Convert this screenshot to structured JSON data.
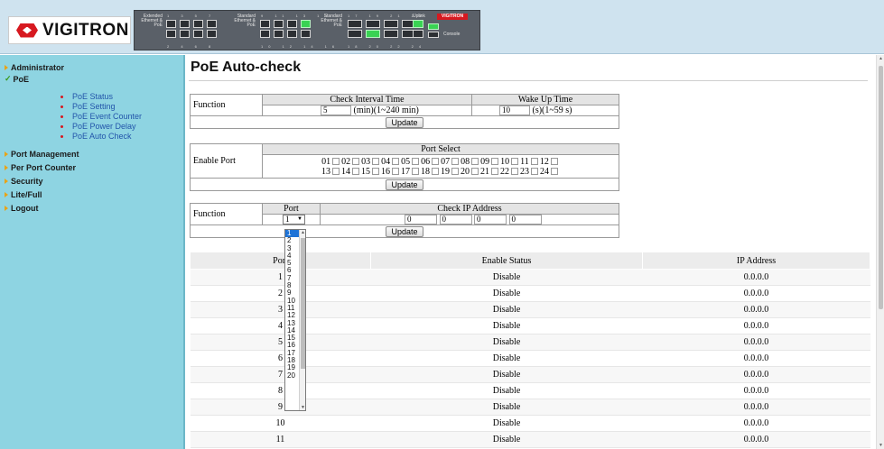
{
  "header": {
    "brand": "VIGITRON",
    "panel_labels": {
      "extended": "Extended Ethernet & PoE",
      "standard1": "Standard Ethernet & PoE",
      "standard2": "Standard Ethernet & PoE",
      "uplink": "Uplink",
      "console": "Console",
      "mini_brand": "VIGITRON"
    }
  },
  "sidebar": {
    "top_items": [
      {
        "label": "Administrator",
        "icon": "arrow-icon"
      },
      {
        "label": "PoE",
        "icon": "check-icon"
      },
      {
        "label": "Port Management",
        "icon": "arrow-icon"
      },
      {
        "label": "Per Port Counter",
        "icon": "arrow-icon"
      },
      {
        "label": "Security",
        "icon": "arrow-icon"
      },
      {
        "label": "Lite/Full",
        "icon": "arrow-icon"
      },
      {
        "label": "Logout",
        "icon": "arrow-icon"
      }
    ],
    "poe_sub_items": [
      {
        "label": "PoE Status"
      },
      {
        "label": "PoE Setting"
      },
      {
        "label": "PoE Event Counter"
      },
      {
        "label": "PoE Power Delay"
      },
      {
        "label": "PoE Auto Check"
      }
    ]
  },
  "main": {
    "title": "PoE Auto-check",
    "interval_table": {
      "row_label": "Function",
      "col1_header": "Check Interval Time",
      "col2_header": "Wake Up Time",
      "interval_value": "5",
      "interval_unit": "(min)(1~240 min)",
      "wake_value": "10",
      "wake_unit": "(s)(1~59 s)",
      "update_label": "Update"
    },
    "enable_table": {
      "row_label": "Enable Port",
      "header": "Port Select",
      "ports_row1": [
        "01",
        "02",
        "03",
        "04",
        "05",
        "06",
        "07",
        "08",
        "09",
        "10",
        "11",
        "12"
      ],
      "ports_row2": [
        "13",
        "14",
        "15",
        "16",
        "17",
        "18",
        "19",
        "20",
        "21",
        "22",
        "23",
        "24"
      ],
      "update_label": "Update"
    },
    "ip_table": {
      "row_label": "Function",
      "port_header": "Port",
      "ip_header": "Check IP Address",
      "port_value": "1",
      "ip_octets": [
        "0",
        "0",
        "0",
        "0"
      ],
      "update_label": "Update"
    },
    "dropdown_options": [
      "1",
      "2",
      "3",
      "4",
      "5",
      "6",
      "7",
      "8",
      "9",
      "10",
      "11",
      "12",
      "13",
      "14",
      "15",
      "16",
      "17",
      "18",
      "19",
      "20"
    ],
    "status_table": {
      "headers": [
        "Port",
        "Enable Status",
        "IP Address"
      ],
      "rows": [
        {
          "port": "1",
          "status": "Disable",
          "ip": "0.0.0.0"
        },
        {
          "port": "2",
          "status": "Disable",
          "ip": "0.0.0.0"
        },
        {
          "port": "3",
          "status": "Disable",
          "ip": "0.0.0.0"
        },
        {
          "port": "4",
          "status": "Disable",
          "ip": "0.0.0.0"
        },
        {
          "port": "5",
          "status": "Disable",
          "ip": "0.0.0.0"
        },
        {
          "port": "6",
          "status": "Disable",
          "ip": "0.0.0.0"
        },
        {
          "port": "7",
          "status": "Disable",
          "ip": "0.0.0.0"
        },
        {
          "port": "8",
          "status": "Disable",
          "ip": "0.0.0.0"
        },
        {
          "port": "9",
          "status": "Disable",
          "ip": "0.0.0.0"
        },
        {
          "port": "10",
          "status": "Disable",
          "ip": "0.0.0.0"
        },
        {
          "port": "11",
          "status": "Disable",
          "ip": "0.0.0.0"
        }
      ]
    }
  },
  "colors": {
    "header_bg": "#cfe3ef",
    "sidebar_bg": "#8ed4e2",
    "brand_red": "#d71920",
    "link_blue": "#2255aa",
    "selected_option": "#1e73d6"
  }
}
